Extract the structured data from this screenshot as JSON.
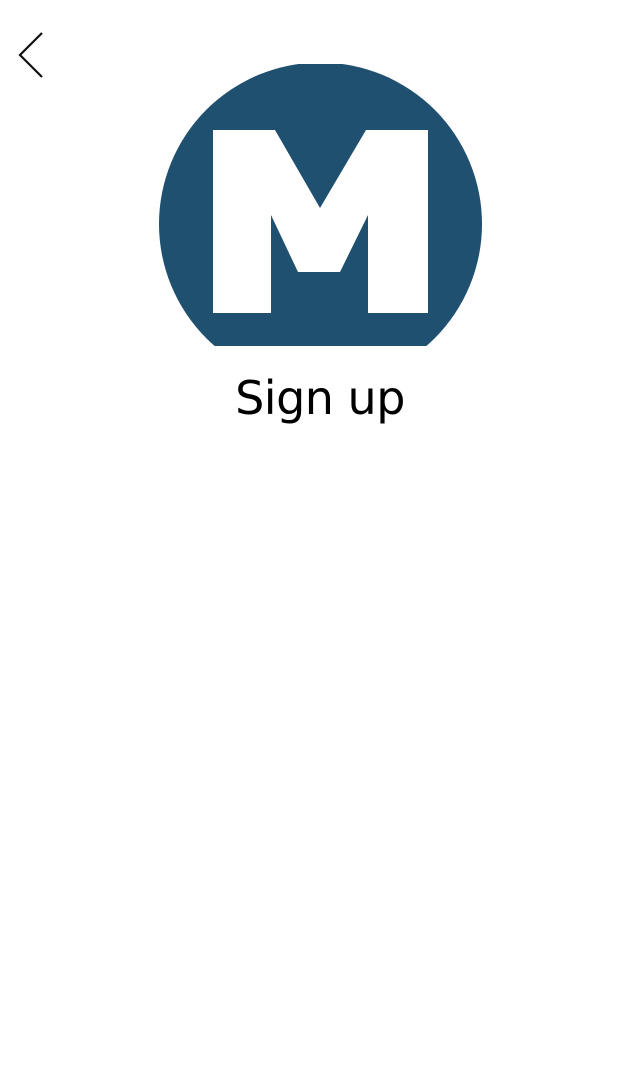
{
  "header": {
    "back_icon": "chevron-left-icon"
  },
  "logo": {
    "letter": "M",
    "icon": "app-logo-m",
    "color": "#1f506f"
  },
  "main": {
    "title": "Sign up"
  }
}
